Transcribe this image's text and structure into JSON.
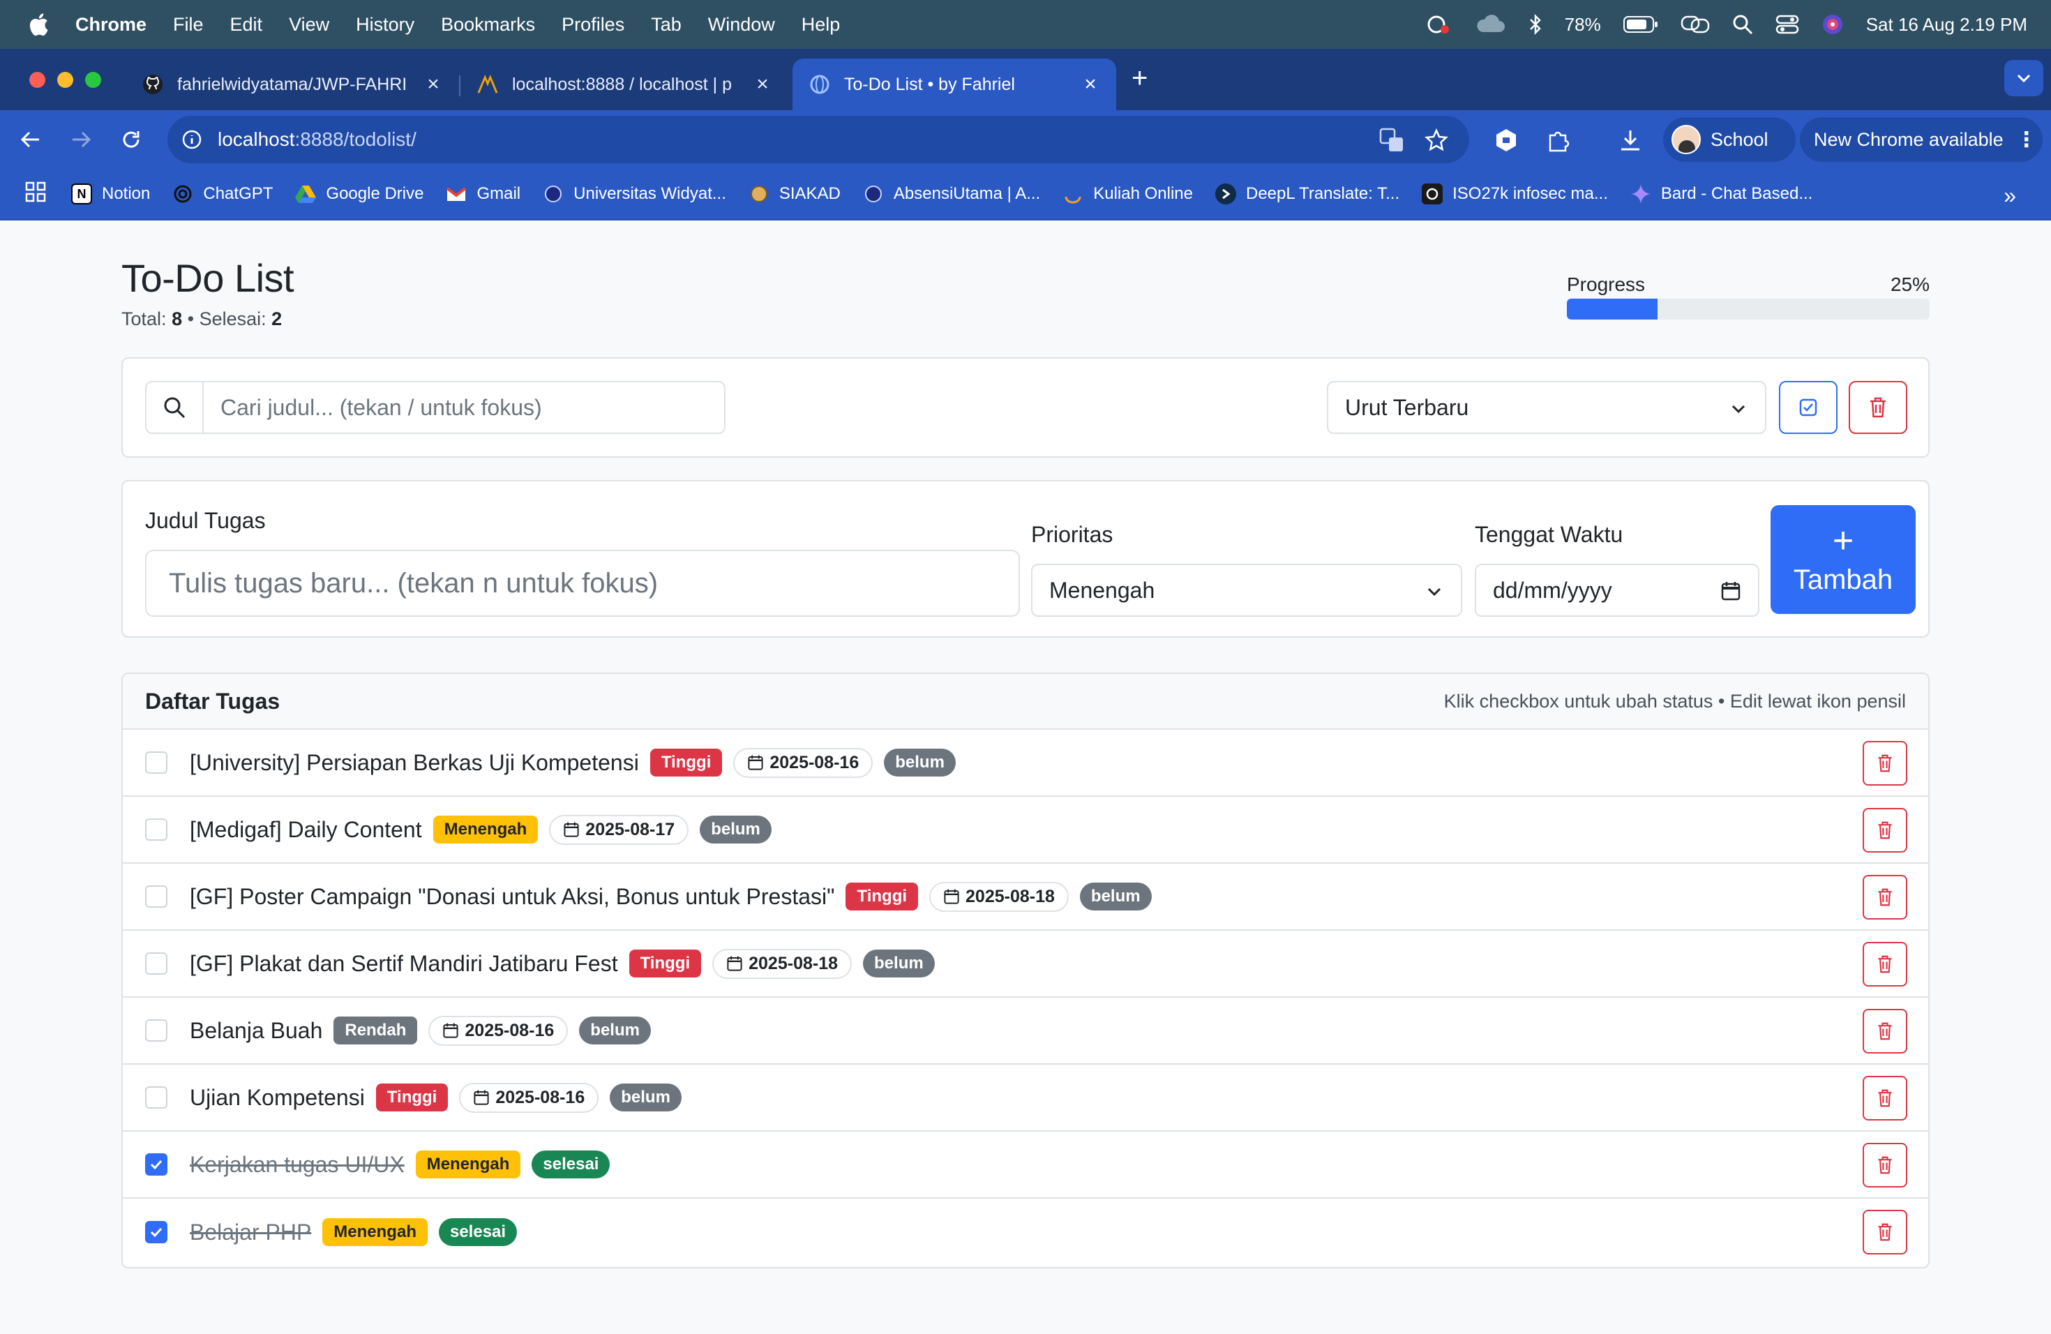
{
  "menubar": {
    "app_name": "Chrome",
    "items": [
      "File",
      "Edit",
      "View",
      "History",
      "Bookmarks",
      "Profiles",
      "Tab",
      "Window",
      "Help"
    ],
    "battery": "78%",
    "datetime": "Sat 16 Aug  2.19 PM"
  },
  "tabs": [
    {
      "title": "fahrielwidyatama/JWP-FAHRI",
      "icon": "github-icon",
      "active": false
    },
    {
      "title": "localhost:8888 / localhost | p",
      "icon": "phpmyadmin-icon",
      "active": false
    },
    {
      "title": "To-Do List • by Fahriel",
      "icon": "globe-icon",
      "active": true
    }
  ],
  "address_bar": {
    "host": "localhost",
    "path": ":8888/todolist/"
  },
  "profile": {
    "name": "School"
  },
  "update_button": "New Chrome available",
  "bookmarks": [
    {
      "label": "Notion",
      "icon": "notion-icon"
    },
    {
      "label": "ChatGPT",
      "icon": "chatgpt-icon"
    },
    {
      "label": "Google Drive",
      "icon": "drive-icon"
    },
    {
      "label": "Gmail",
      "icon": "gmail-icon"
    },
    {
      "label": "Universitas Widyat...",
      "icon": "university-icon"
    },
    {
      "label": "SIAKAD",
      "icon": "siakad-icon"
    },
    {
      "label": "AbsensiUtama | A...",
      "icon": "absensi-icon"
    },
    {
      "label": "Kuliah Online",
      "icon": "kuliah-icon"
    },
    {
      "label": "DeepL Translate: T...",
      "icon": "deepl-icon"
    },
    {
      "label": "ISO27k infosec ma...",
      "icon": "iso-icon"
    },
    {
      "label": "Bard - Chat Based...",
      "icon": "bard-icon"
    }
  ],
  "page": {
    "title": "To-Do List",
    "total_label": "Total:",
    "total": "8",
    "done_label": "Selesai:",
    "done": "2",
    "progress_label": "Progress",
    "progress_text": "25%",
    "progress_value": 0.25
  },
  "toolbar": {
    "search_placeholder": "Cari judul... (tekan / untuk fokus)",
    "sort_value": "Urut Terbaru"
  },
  "form": {
    "title_label": "Judul Tugas",
    "title_placeholder": "Tulis tugas baru... (tekan n untuk fokus)",
    "priority_label": "Prioritas",
    "priority_value": "Menengah",
    "deadline_label": "Tenggat Waktu",
    "deadline_placeholder": "dd/mm/yyyy",
    "add_label": "Tambah"
  },
  "list": {
    "header": "Daftar Tugas",
    "hint": "Klik checkbox untuk ubah status • Edit lewat ikon pensil",
    "items": [
      {
        "title": "[University] Persiapan Berkas Uji Kompetensi",
        "priority": "Tinggi",
        "date": "2025-08-16",
        "status": "belum",
        "done": false
      },
      {
        "title": "[Medigaf] Daily Content",
        "priority": "Menengah",
        "date": "2025-08-17",
        "status": "belum",
        "done": false
      },
      {
        "title": "[GF] Poster Campaign \"Donasi untuk Aksi, Bonus untuk Prestasi\"",
        "priority": "Tinggi",
        "date": "2025-08-18",
        "status": "belum",
        "done": false
      },
      {
        "title": "[GF] Plakat dan Sertif Mandiri Jatibaru Fest",
        "priority": "Tinggi",
        "date": "2025-08-18",
        "status": "belum",
        "done": false
      },
      {
        "title": "Belanja Buah",
        "priority": "Rendah",
        "date": "2025-08-16",
        "status": "belum",
        "done": false
      },
      {
        "title": "Ujian Kompetensi",
        "priority": "Tinggi",
        "date": "2025-08-16",
        "status": "belum",
        "done": false
      },
      {
        "title": "Kerjakan tugas UI/UX",
        "priority": "Menengah",
        "date": "",
        "status": "selesai",
        "done": true
      },
      {
        "title": "Belajar PHP",
        "priority": "Menengah",
        "date": "",
        "status": "selesai",
        "done": true
      }
    ]
  },
  "colors": {
    "accent": "#2f6df6",
    "danger": "#dc3545",
    "warning": "#ffc107",
    "success": "#198754",
    "secondary": "#6c757d",
    "browser_frame": "#2b59c3"
  }
}
